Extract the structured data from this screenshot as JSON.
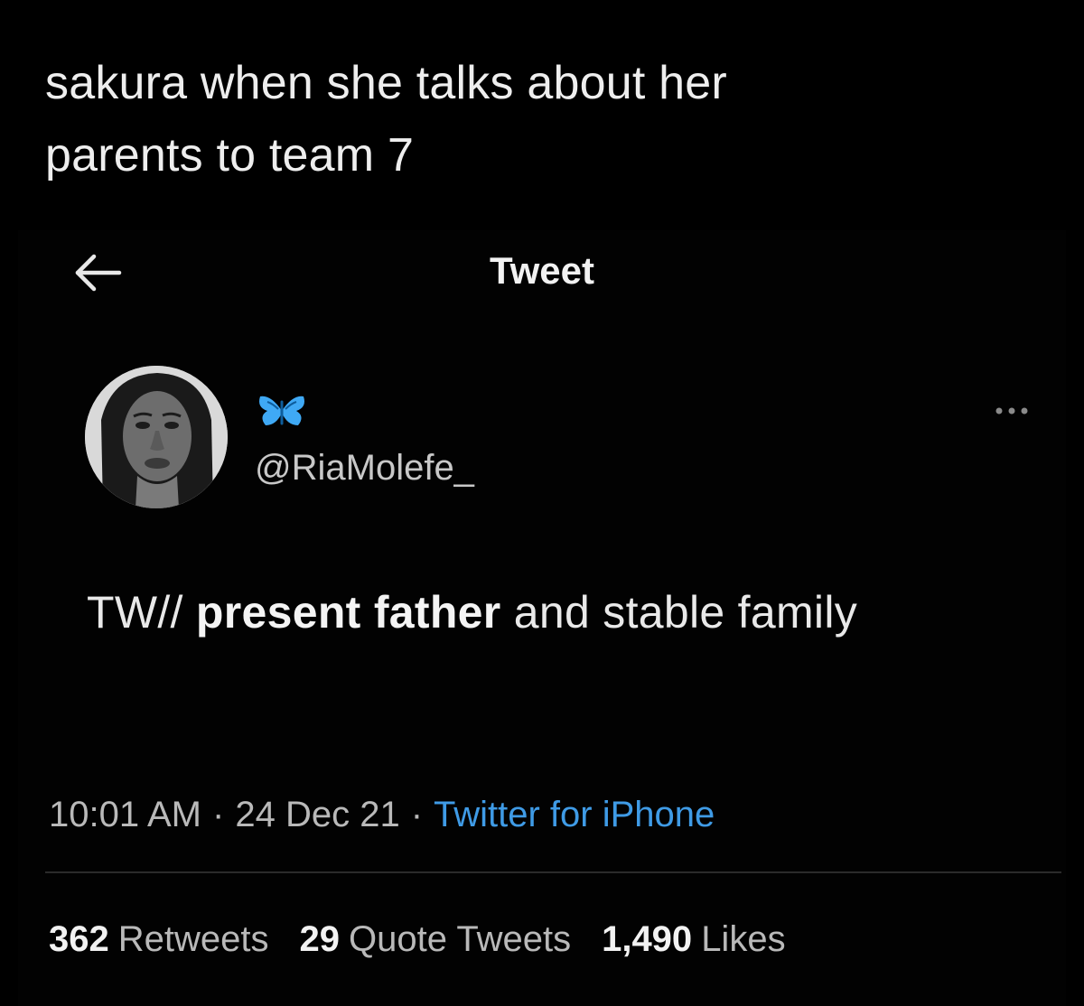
{
  "caption": {
    "line1": "sakura when she talks about her",
    "line2": "parents to team 7"
  },
  "topbar": {
    "title": "Tweet",
    "back_icon": "arrow-left-icon"
  },
  "author": {
    "display_name_icon": "butterfly-icon",
    "handle": "@RiaMolefe_",
    "avatar": "avatar",
    "more_icon": "more-horizontal-icon"
  },
  "tweet": {
    "prefix": "TW//",
    "bold": "present father",
    "rest": "and stable family"
  },
  "meta": {
    "time": "10:01 AM",
    "sep1": "·",
    "date": "24 Dec 21",
    "sep2": "·",
    "source": "Twitter for iPhone"
  },
  "stats": {
    "retweets_count": "362",
    "retweets_label": "Retweets",
    "quotes_count": "29",
    "quotes_label": "Quote Tweets",
    "likes_count": "1,490",
    "likes_label": "Likes"
  },
  "colors": {
    "background": "#000000",
    "link": "#3f9be6",
    "butterfly": "#3fa9f5"
  }
}
